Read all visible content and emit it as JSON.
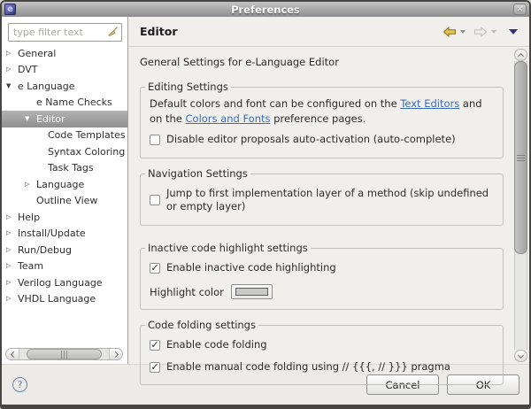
{
  "window": {
    "title": "Preferences"
  },
  "icons": {
    "close": "×",
    "collapsed": "▷",
    "expanded": "▼",
    "check": "✓",
    "help": "?"
  },
  "colors": {
    "link_blue": "#3b6db5",
    "back_arrow_gold": "#e5c253",
    "view_menu_navy": "#32326e",
    "highlight_swatch": "#c9c9c9",
    "selection_gray": "#9f9f9f"
  },
  "sidebar": {
    "filter_placeholder": "type filter text",
    "tree": [
      {
        "label": "General"
      },
      {
        "label": "DVT"
      },
      {
        "label": "e Language"
      },
      {
        "label": "e Name Checks"
      },
      {
        "label": "Editor"
      },
      {
        "label": "Code Templates"
      },
      {
        "label": "Syntax Coloring"
      },
      {
        "label": "Task Tags"
      },
      {
        "label": "Language"
      },
      {
        "label": "Outline View"
      },
      {
        "label": "Help"
      },
      {
        "label": "Install/Update"
      },
      {
        "label": "Run/Debug"
      },
      {
        "label": "Team"
      },
      {
        "label": "Verilog Language"
      },
      {
        "label": "VHDL Language"
      }
    ]
  },
  "header": {
    "title": "Editor"
  },
  "content": {
    "intro": "General Settings for e-Language Editor",
    "editing": {
      "title": "Editing Settings",
      "desc_part1": "Default colors and font can be configured on the ",
      "link1": "Text Editors",
      "desc_part2": " and on the ",
      "link2": "Colors and Fonts",
      "desc_part3": " preference pages.",
      "checkbox_label": "Disable editor proposals auto-activation (auto-complete)",
      "checked": false
    },
    "navigation": {
      "title": "Navigation Settings",
      "checkbox_label": "Jump to first implementation layer of a method (skip undefined or empty layer)",
      "checked": false
    },
    "inactive": {
      "title": "Inactive code highlight settings",
      "checkbox_label": "Enable inactive code highlighting",
      "checked": true,
      "highlight_label": "Highlight color",
      "swatch_color": "#c9c9c9"
    },
    "folding": {
      "title": "Code folding settings",
      "checkbox1_label": "Enable code folding",
      "checkbox1_checked": true,
      "checkbox2_label": "Enable manual code folding using // {{{, // }}} pragma",
      "checkbox2_checked": true
    }
  },
  "footer": {
    "cancel_label": "Cancel",
    "ok_label": "OK"
  }
}
